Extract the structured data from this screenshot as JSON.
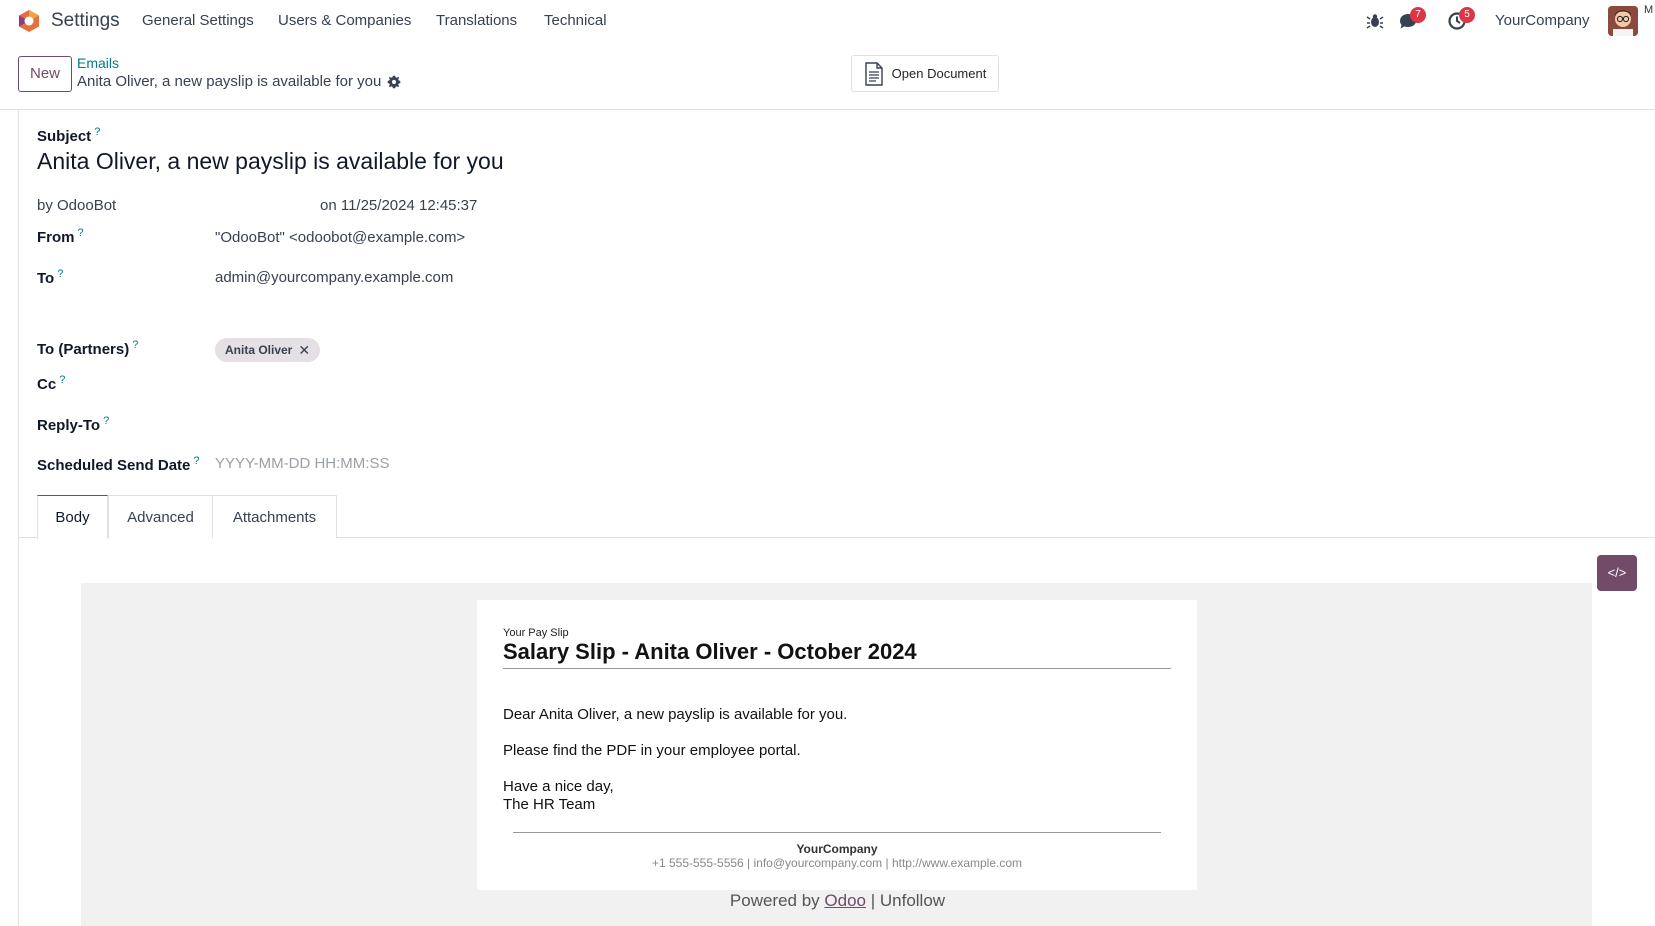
{
  "navbar": {
    "app_name": "Settings",
    "menu": [
      "General Settings",
      "Users & Companies",
      "Translations",
      "Technical"
    ],
    "messages_count": "7",
    "activities_count": "5",
    "company": "YourCompany",
    "avatar_extra": "M"
  },
  "control_panel": {
    "new_label": "New",
    "breadcrumb": "Emails",
    "record_title": "Anita Oliver, a new payslip is available for you",
    "open_document_label": "Open Document"
  },
  "form": {
    "subject_label": "Subject",
    "subject_value": "Anita Oliver, a new payslip is available for you",
    "author": "by OdooBot",
    "date": "on 11/25/2024 12:45:37",
    "from_label": "From",
    "from_value": "\"OdooBot\" <odoobot@example.com>",
    "to_label": "To",
    "to_value": "admin@yourcompany.example.com",
    "to_partners_label": "To (Partners)",
    "to_partners_tag": "Anita Oliver",
    "cc_label": "Cc",
    "reply_to_label": "Reply-To",
    "scheduled_label": "Scheduled Send Date",
    "scheduled_placeholder": "YYYY-MM-DD HH:MM:SS",
    "help_mark": "?"
  },
  "tabs": [
    "Body",
    "Advanced",
    "Attachments"
  ],
  "code_button": "</>",
  "email": {
    "small_heading": "Your Pay Slip",
    "heading": "Salary Slip - Anita Oliver - October 2024",
    "line1": "Dear Anita Oliver, a new payslip is available for you.",
    "line2": "Please find the PDF in your employee portal.",
    "line3": "Have a nice day,",
    "line4": "The HR Team",
    "company_name": "YourCompany",
    "company_contact": "+1 555-555-5556 | info@yourcompany.com | http://www.example.com",
    "powered_prefix": "Powered by ",
    "powered_link": "Odoo",
    "powered_sep": " | ",
    "unfollow": "Unfollow"
  },
  "colors": {
    "brand": "#714b67",
    "link": "#017e84",
    "badge": "#dc3545"
  }
}
